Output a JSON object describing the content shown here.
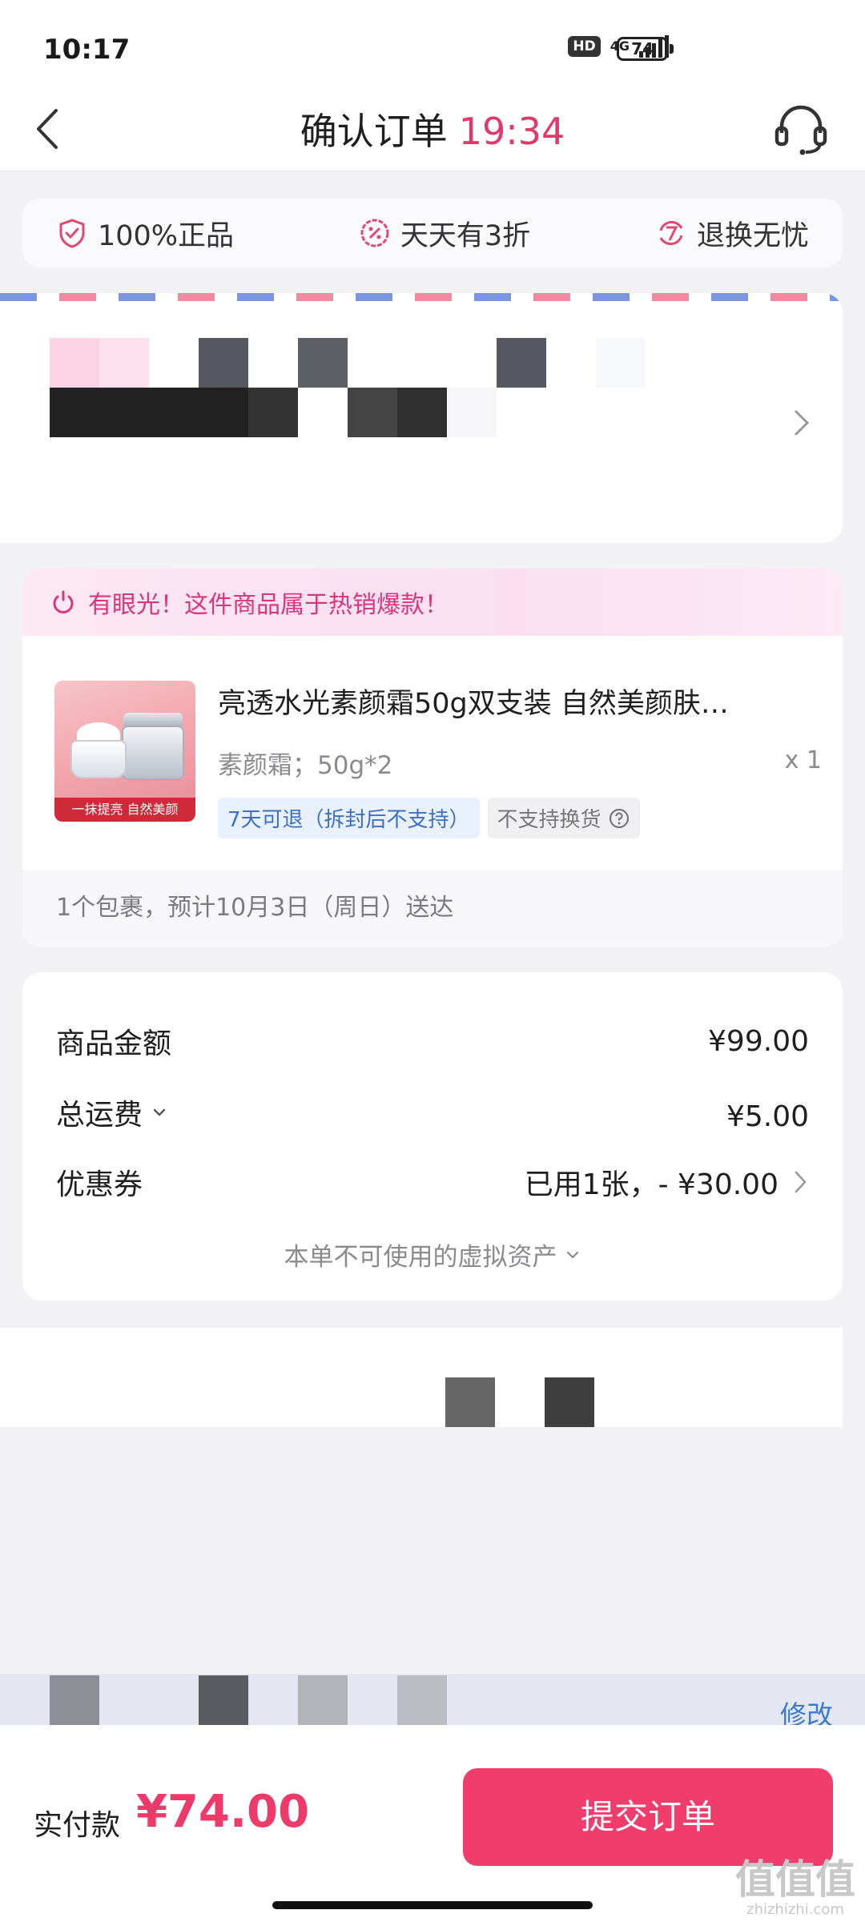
{
  "status_bar": {
    "time": "10:17",
    "hd": "HD",
    "network": "4G",
    "battery": "74"
  },
  "header": {
    "title": "确认订单",
    "timer": "19:34",
    "back_icon": "chevron-left-icon",
    "service_icon": "headset-icon"
  },
  "guarantees": [
    {
      "label": "100%正品",
      "icon": "shield-check-icon"
    },
    {
      "label": "天天有3折",
      "icon": "percent-badge-icon"
    },
    {
      "label": "退换无忧",
      "icon": "return-7-icon"
    }
  ],
  "product": {
    "hot_banner": "有眼光！这件商品属于热销爆款！",
    "name": "亮透水光素颜霜50g双支装 自然美颜肤…",
    "image_caption": "一抹提亮 自然美颜",
    "spec": "素颜霜；50g*2",
    "quantity": "x 1",
    "tags": [
      "7天可退（拆封后不支持）",
      "不支持换货"
    ],
    "delivery": "1个包裹，预计10月3日（周日）送达"
  },
  "price": {
    "items": [
      {
        "label": "商品金额",
        "value": "¥99.00"
      },
      {
        "label": "总运费",
        "value": "¥5.00"
      },
      {
        "label": "优惠券",
        "value": "已用1张，- ¥30.00"
      }
    ],
    "assets_link": "本单不可使用的虚拟资产"
  },
  "recipient": {
    "modify": "修改"
  },
  "footer": {
    "pay_label": "实付款",
    "pay_amount": "¥74.00",
    "submit": "提交订单"
  },
  "watermark": {
    "glyphs": "值值值",
    "domain": "zhizhizhi.com"
  },
  "colors": {
    "accent": "#f03d6c",
    "timer": "#e03a6a",
    "link": "#3d7cc9",
    "tag_blue": "#3d6fc2"
  }
}
